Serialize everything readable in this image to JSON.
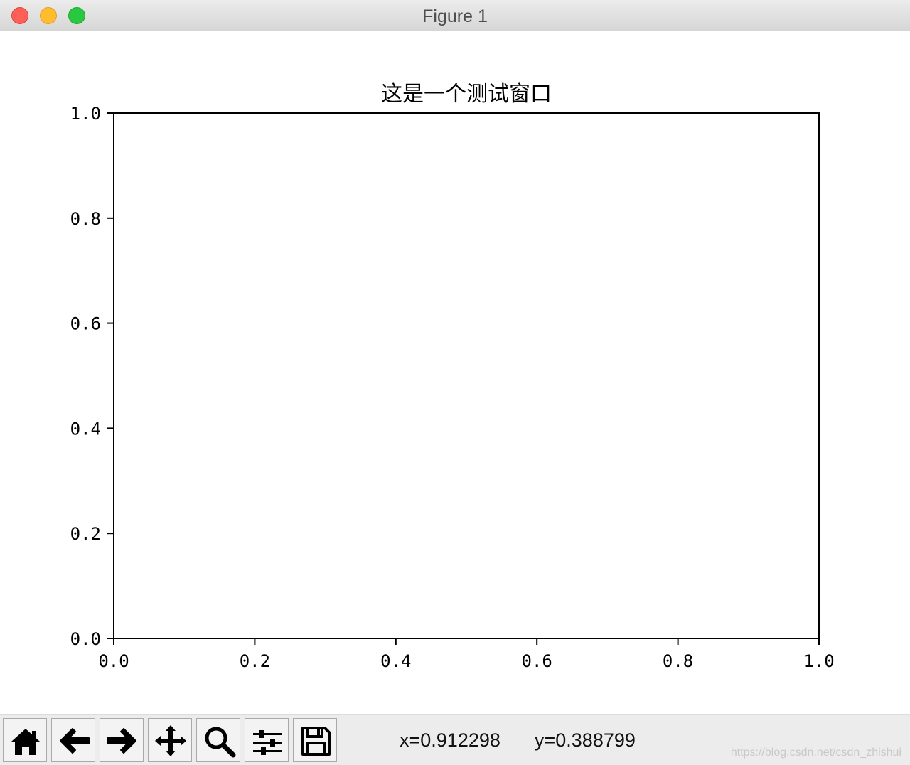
{
  "window": {
    "title": "Figure 1"
  },
  "chart_data": {
    "type": "line",
    "title": "这是一个测试窗口",
    "xlabel": "",
    "ylabel": "",
    "xlim": [
      0.0,
      1.0
    ],
    "ylim": [
      0.0,
      1.0
    ],
    "xticks": [
      "0.0",
      "0.2",
      "0.4",
      "0.6",
      "0.8",
      "1.0"
    ],
    "yticks": [
      "0.0",
      "0.2",
      "0.4",
      "0.6",
      "0.8",
      "1.0"
    ],
    "series": [],
    "grid": false
  },
  "toolbar": {
    "buttons": [
      {
        "name": "home-button",
        "icon": "home-icon"
      },
      {
        "name": "back-button",
        "icon": "arrow-left-icon"
      },
      {
        "name": "forward-button",
        "icon": "arrow-right-icon"
      },
      {
        "name": "pan-button",
        "icon": "move-icon"
      },
      {
        "name": "zoom-button",
        "icon": "magnifier-icon"
      },
      {
        "name": "configure-subplots-button",
        "icon": "sliders-icon"
      },
      {
        "name": "save-button",
        "icon": "floppy-disk-icon"
      }
    ],
    "x_readout": "x=0.912298",
    "y_readout": "y=0.388799"
  },
  "watermark": "https://blog.csdn.net/csdn_zhishui"
}
